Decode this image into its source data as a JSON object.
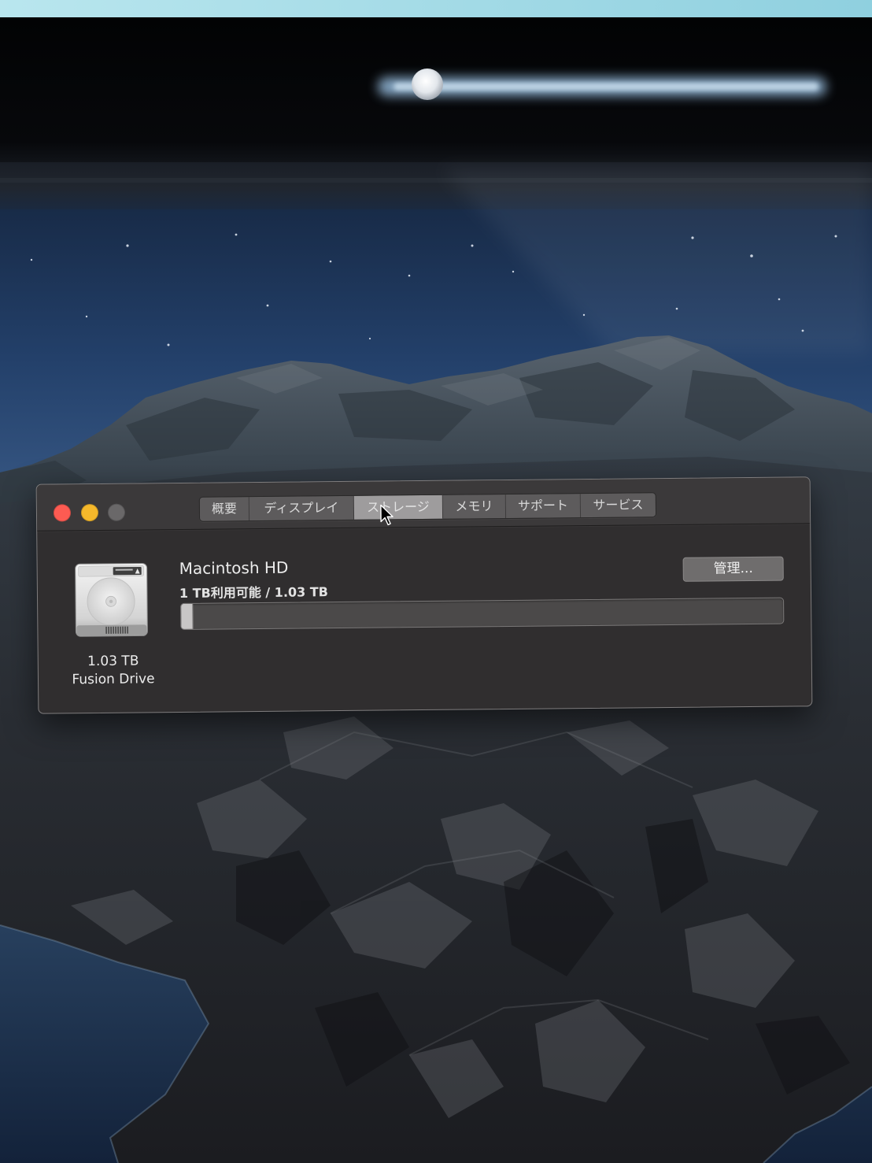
{
  "window": {
    "traffic_lights": {
      "close": {
        "icon": "close-icon",
        "color": "#fd5b52"
      },
      "minimize": {
        "icon": "minimize-icon",
        "color": "#f5b82b"
      },
      "zoom": {
        "icon": "zoom-icon",
        "color": "#6a6869",
        "enabled": false
      }
    },
    "tabs": [
      {
        "label": "概要",
        "selected": false
      },
      {
        "label": "ディスプレイ",
        "selected": false
      },
      {
        "label": "ストレージ",
        "selected": true
      },
      {
        "label": "メモリ",
        "selected": false
      },
      {
        "label": "サポート",
        "selected": false
      },
      {
        "label": "サービス",
        "selected": false
      }
    ]
  },
  "storage": {
    "drive_icon": "hard-drive-icon",
    "drive_capacity": "1.03 TB",
    "drive_type": "Fusion Drive",
    "volume_name": "Macintosh HD",
    "availability": "1 TB利用可能 / 1.03 TB",
    "manage_button_label": "管理...",
    "used_fraction": 0.02
  },
  "pointer": {
    "icon": "mouse-pointer-icon"
  },
  "colors": {
    "window_bg": "#302e2f",
    "titlebar_bg": "#3b393a",
    "tab_bg": "#5d5b5c",
    "tab_selected_bg": "#9e9c9d",
    "text_primary": "#ececec",
    "bar_track": "#4b4949",
    "bar_fill": "#c8c6c6",
    "button_bg": "#6f6d6d"
  }
}
